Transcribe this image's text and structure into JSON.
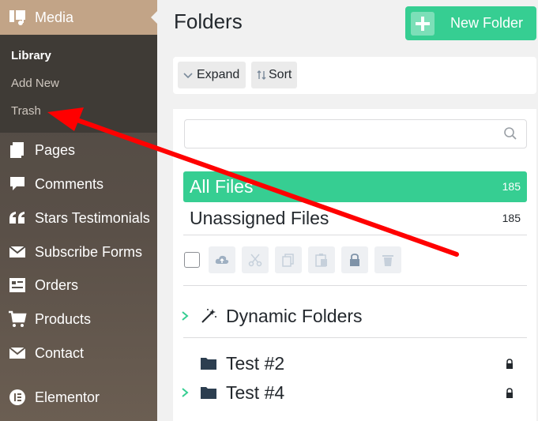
{
  "sidebar": {
    "media": {
      "label": "Media",
      "icon": "media-icon"
    },
    "submenu": [
      {
        "label": "Library",
        "current": true
      },
      {
        "label": "Add New"
      },
      {
        "label": "Trash"
      }
    ],
    "items": [
      {
        "label": "Pages",
        "icon": "pages-icon"
      },
      {
        "label": "Comments",
        "icon": "comments-icon"
      },
      {
        "label": "Stars Testimonials",
        "icon": "quote-icon"
      },
      {
        "label": "Subscribe Forms",
        "icon": "envelope-icon"
      },
      {
        "label": "Orders",
        "icon": "orders-icon"
      },
      {
        "label": "Products",
        "icon": "cart-icon"
      },
      {
        "label": "Contact",
        "icon": "envelope-icon"
      },
      {
        "label": "Elementor",
        "icon": "elementor-icon"
      }
    ]
  },
  "main": {
    "title": "Folders",
    "new_folder_label": "New Folder",
    "toolbar": {
      "expand_label": "Expand",
      "sort_label": "Sort"
    },
    "search": {
      "placeholder": ""
    },
    "files": [
      {
        "label": "All Files",
        "count": "185",
        "active": true
      },
      {
        "label": "Unassigned Files",
        "count": "185"
      }
    ],
    "tree": [
      {
        "label": "Dynamic Folders",
        "icon": "magic-wand-icon",
        "expandable": true
      },
      {
        "label": "Test #2",
        "icon": "folder-icon",
        "locked": true,
        "expandable": false
      },
      {
        "label": "Test #4",
        "icon": "folder-icon",
        "locked": true,
        "expandable": true
      }
    ]
  },
  "colors": {
    "accent": "#36ce92",
    "media_active": "#c2a487",
    "arrow": "#ff0000"
  }
}
